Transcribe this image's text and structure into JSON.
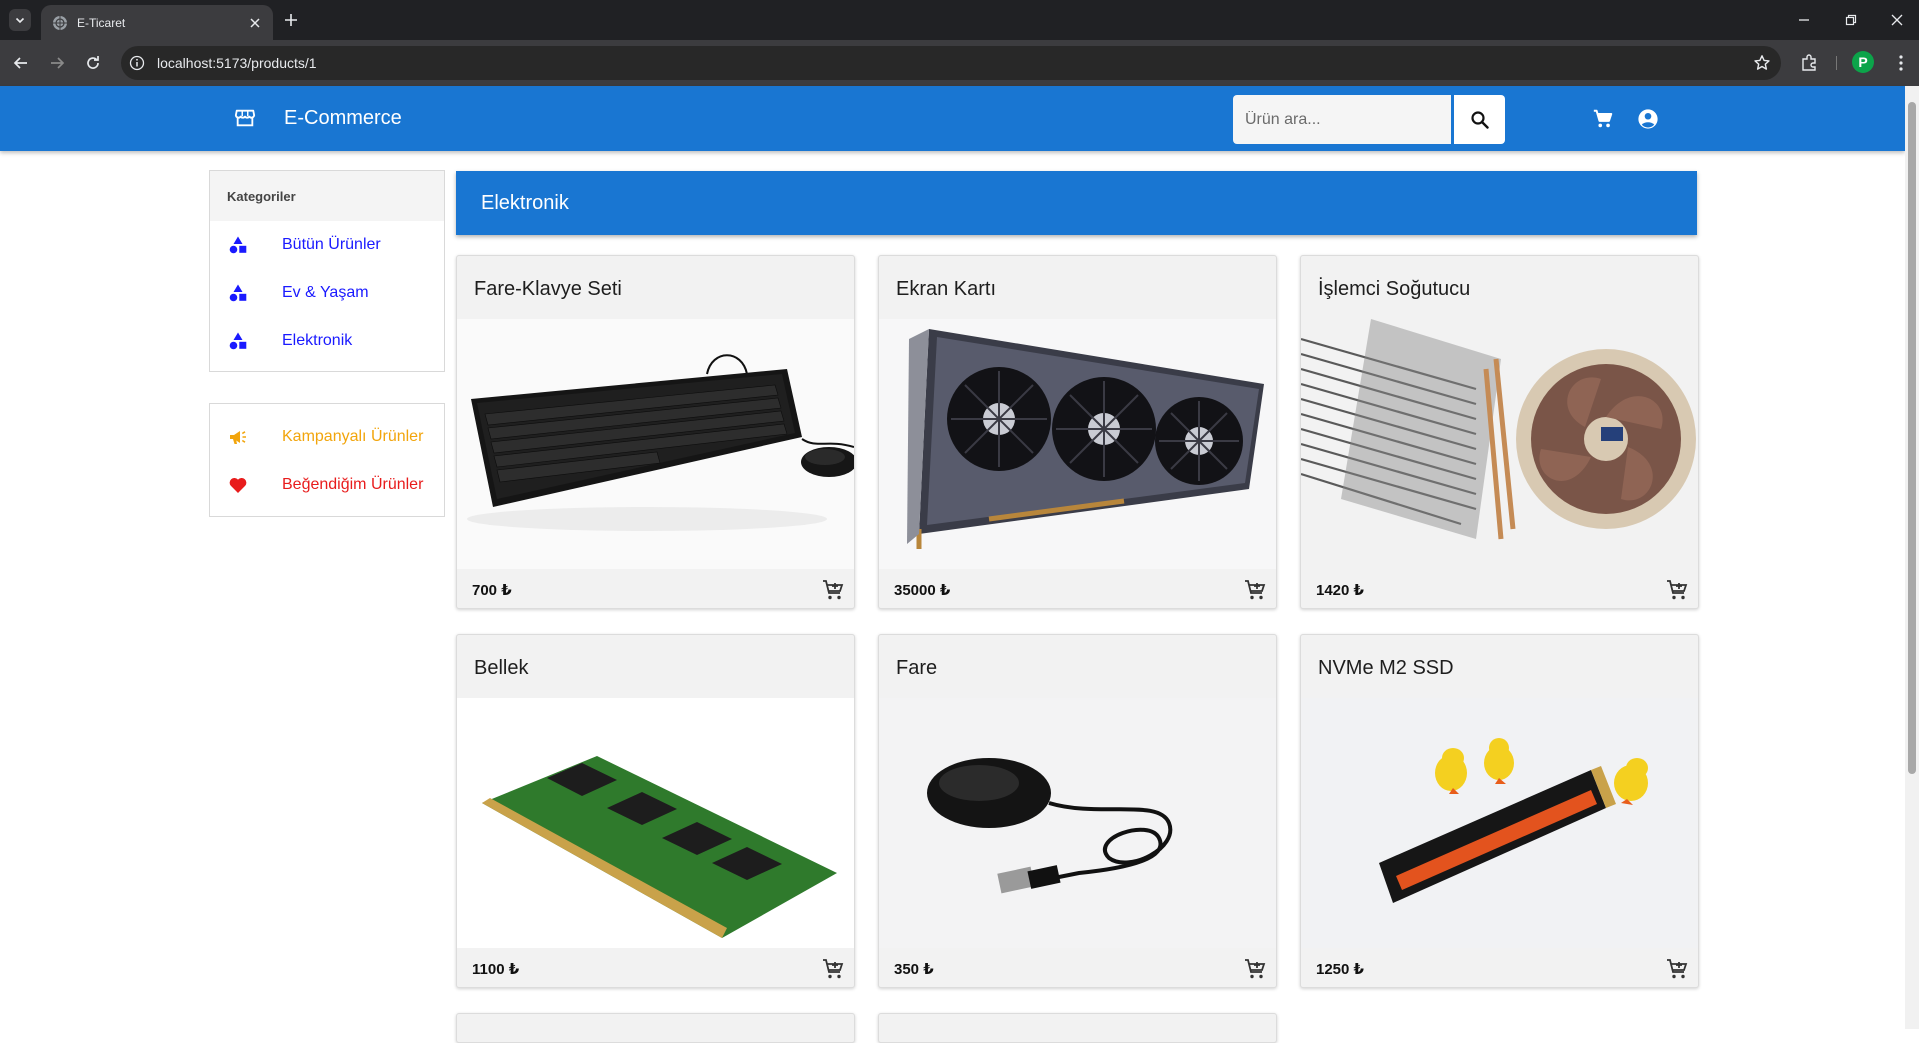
{
  "browser": {
    "tab_title": "E-Ticaret",
    "url": "localhost:5173/products/1",
    "profile_initial": "P"
  },
  "header": {
    "brand": "E-Commerce",
    "search_placeholder": "Ürün ara..."
  },
  "sidebar": {
    "categories_title": "Kategoriler",
    "categories": [
      {
        "label": "Bütün Ürünler",
        "icon": "category-icon"
      },
      {
        "label": "Ev & Yaşam",
        "icon": "category-icon"
      },
      {
        "label": "Elektronik",
        "icon": "category-icon"
      }
    ],
    "extras": [
      {
        "label": "Kampanyalı Ürünler",
        "icon": "campaign-icon"
      },
      {
        "label": "Beğendiğim Ürünler",
        "icon": "heart-icon"
      }
    ]
  },
  "main": {
    "category_title": "Elektronik",
    "products": [
      {
        "name": "Fare-Klavye Seti",
        "price": "700 ₺",
        "image": "keyboard-mouse-image"
      },
      {
        "name": "Ekran Kartı",
        "price": "35000 ₺",
        "image": "graphics-card-image"
      },
      {
        "name": "İşlemci Soğutucu",
        "price": "1420 ₺",
        "image": "cpu-cooler-image"
      },
      {
        "name": "Bellek",
        "price": "1100 ₺",
        "image": "ram-module-image"
      },
      {
        "name": "Fare",
        "price": "350 ₺",
        "image": "mouse-image"
      },
      {
        "name": "NVMe M2 SSD",
        "price": "1250 ₺",
        "image": "nvme-ssd-image"
      }
    ]
  },
  "colors": {
    "primary": "#1976d2",
    "category_link": "#1a1aff",
    "campaign": "#f2a50c",
    "favorite": "#e81c1c"
  }
}
